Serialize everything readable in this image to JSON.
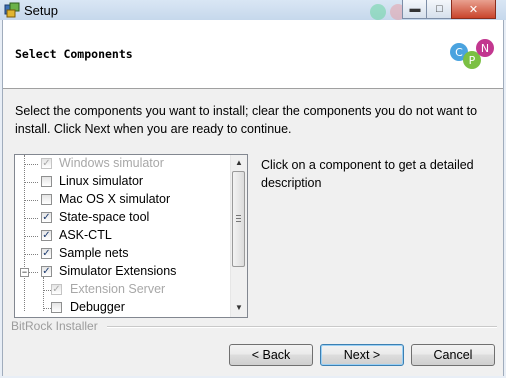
{
  "window": {
    "title": "Setup"
  },
  "header": {
    "title": "Select Components",
    "logo_letters": [
      "C",
      "P",
      "N"
    ]
  },
  "instructions": "Select the components you want to install; clear the components you do not want to install. Click Next when you are ready to continue.",
  "components": [
    {
      "label": "Windows simulator",
      "checked": true,
      "disabled": true
    },
    {
      "label": "Linux simulator",
      "checked": false,
      "disabled": false
    },
    {
      "label": "Mac OS X simulator",
      "checked": false,
      "disabled": false
    },
    {
      "label": "State-space tool",
      "checked": true,
      "disabled": false
    },
    {
      "label": "ASK-CTL",
      "checked": true,
      "disabled": false
    },
    {
      "label": "Sample nets",
      "checked": true,
      "disabled": false
    },
    {
      "label": "Simulator Extensions",
      "checked": true,
      "disabled": false,
      "expanded": true
    },
    {
      "label": "Extension Server",
      "checked": true,
      "disabled": true,
      "child": true
    },
    {
      "label": "Debugger",
      "checked": false,
      "disabled": false,
      "child": true
    }
  ],
  "description": "Click on a component to get a detailed description",
  "footer": {
    "installer_label": "BitRock Installer"
  },
  "buttons": {
    "back": "< Back",
    "next": "Next >",
    "cancel": "Cancel"
  },
  "colors": {
    "logo_c": "#4aa3df",
    "logo_p": "#7bc043",
    "logo_n": "#c2378f"
  },
  "icons": {
    "app": "setup-app-icon",
    "minimize": "minimize-icon",
    "maximize": "maximize-icon",
    "close": "close-icon"
  }
}
